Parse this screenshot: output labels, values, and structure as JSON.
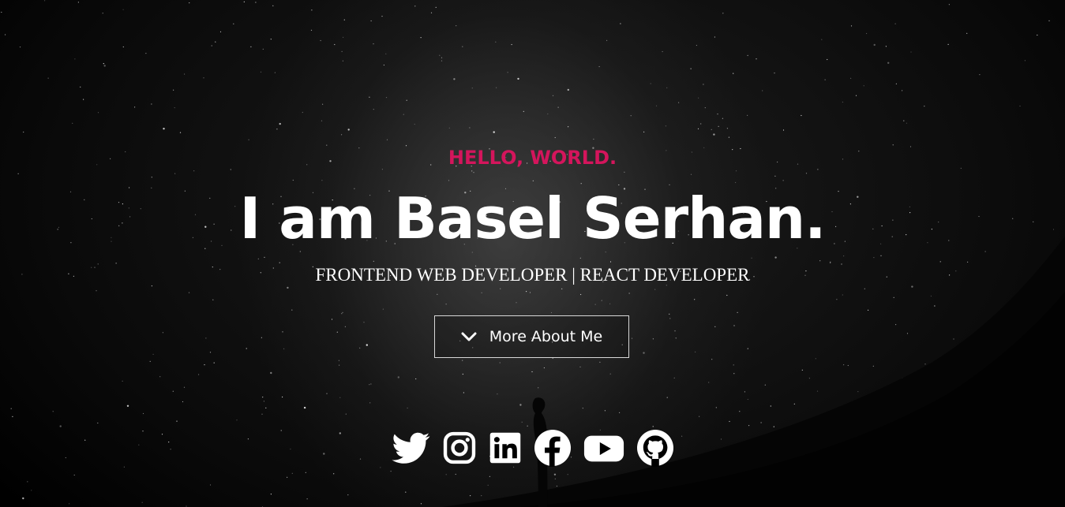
{
  "hero": {
    "greeting": "HELLO, WORLD.",
    "name": "I am Basel Serhan.",
    "tagline": "FRONTEND WEB DEVELOPER | REACT DEVELOPER",
    "button_label": "More About Me"
  },
  "socials": [
    {
      "icon": "twitter-icon"
    },
    {
      "icon": "instagram-icon"
    },
    {
      "icon": "linkedin-icon"
    },
    {
      "icon": "facebook-icon"
    },
    {
      "icon": "youtube-icon"
    },
    {
      "icon": "github-icon"
    }
  ],
  "colors": {
    "accent": "#d4155c",
    "text": "#ffffff",
    "background": "#000000"
  }
}
